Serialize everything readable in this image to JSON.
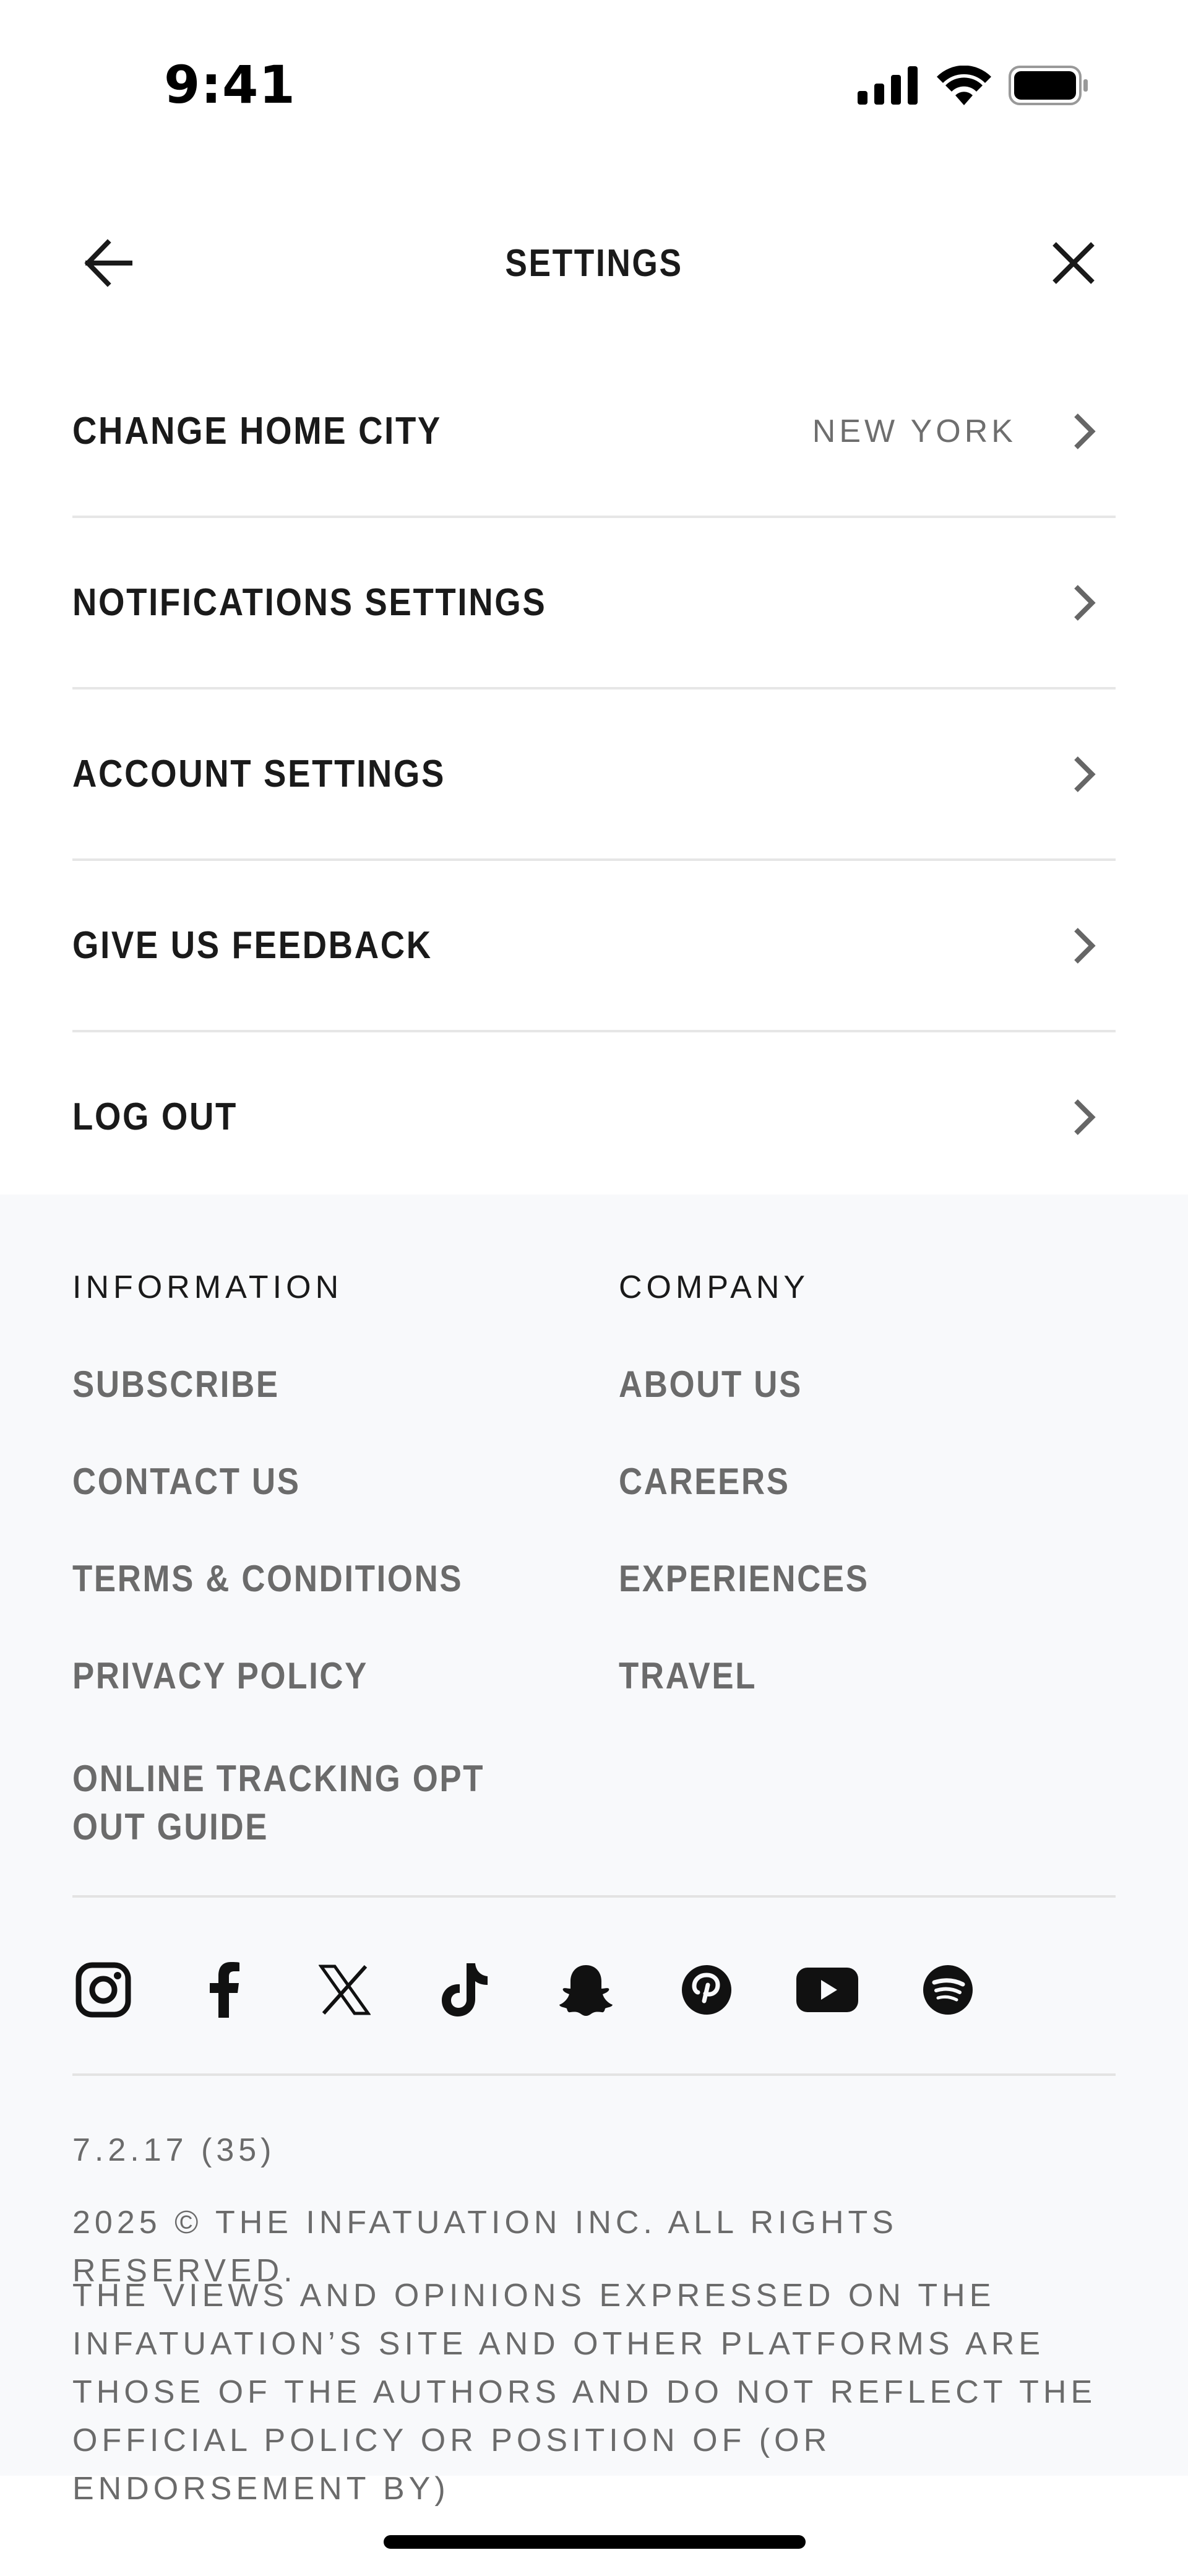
{
  "status_bar": {
    "time": "9:41"
  },
  "nav": {
    "title": "SETTINGS"
  },
  "settings": [
    {
      "label": "CHANGE HOME CITY",
      "value": "NEW YORK"
    },
    {
      "label": "NOTIFICATIONS SETTINGS",
      "value": ""
    },
    {
      "label": "ACCOUNT SETTINGS",
      "value": ""
    },
    {
      "label": "GIVE US FEEDBACK",
      "value": ""
    },
    {
      "label": "LOG OUT",
      "value": ""
    }
  ],
  "footer": {
    "information": {
      "heading": "INFORMATION",
      "links": [
        "SUBSCRIBE",
        "CONTACT US",
        "TERMS & CONDITIONS",
        "PRIVACY POLICY",
        "ONLINE TRACKING OPT OUT GUIDE"
      ]
    },
    "company": {
      "heading": "COMPANY",
      "links": [
        "ABOUT US",
        "CAREERS",
        "EXPERIENCES",
        "TRAVEL"
      ]
    },
    "social_icons": [
      "instagram-icon",
      "facebook-icon",
      "x-icon",
      "tiktok-icon",
      "snapchat-icon",
      "pinterest-icon",
      "youtube-icon",
      "spotify-icon"
    ],
    "version": "7.2.17 (35)",
    "copyright": "2025 © THE INFATUATION INC. ALL RIGHTS RESERVED.",
    "disclaimer": "THE VIEWS AND OPINIONS EXPRESSED ON THE INFATUATION’S SITE AND OTHER PLATFORMS ARE THOSE OF THE AUTHORS AND DO NOT REFLECT THE OFFICIAL POLICY OR POSITION OF (OR ENDORSEMENT BY)"
  },
  "colors": {
    "footer_bg": "#f8f9fb",
    "link_gray": "#6b6b6b",
    "text_dark": "#1a1a1a"
  }
}
